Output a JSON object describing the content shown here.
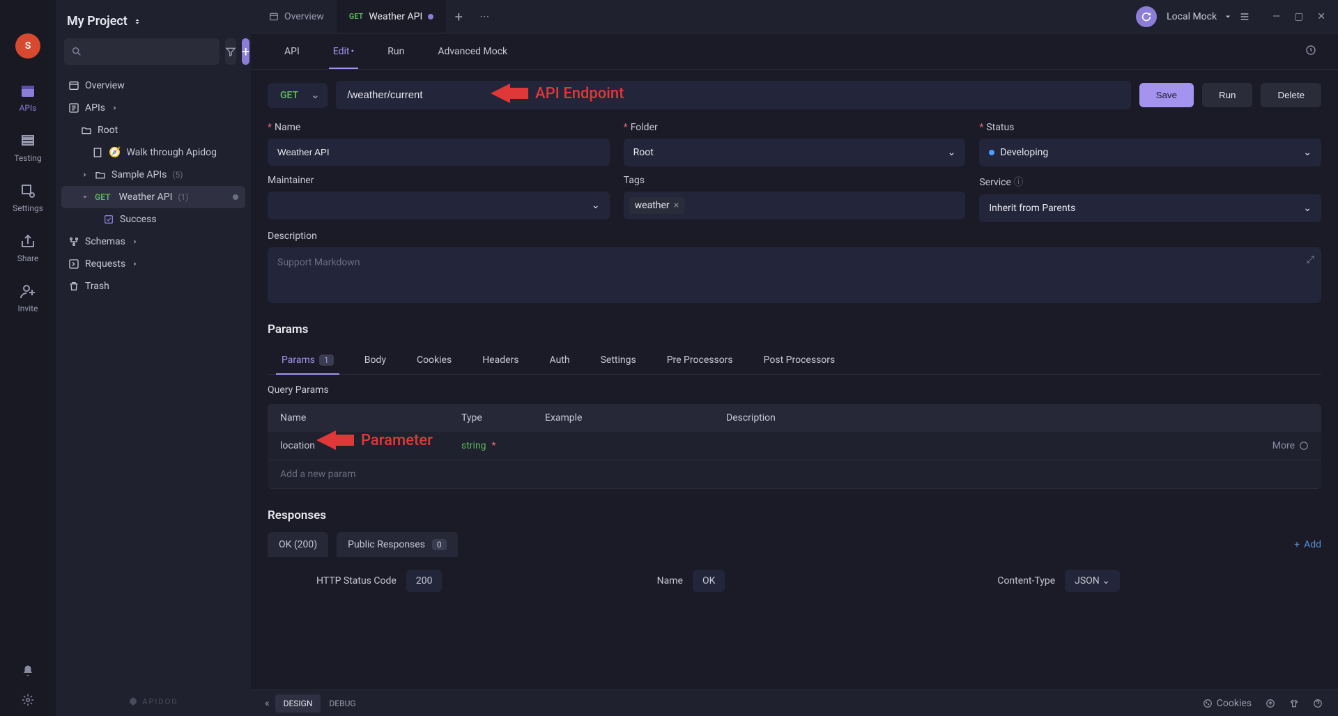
{
  "sidebar_narrow": {
    "avatar_letter": "S",
    "items": [
      {
        "label": "APIs",
        "icon": "calendar"
      },
      {
        "label": "Testing",
        "icon": "testing"
      },
      {
        "label": "Settings",
        "icon": "settings"
      },
      {
        "label": "Share",
        "icon": "share"
      },
      {
        "label": "Invite",
        "icon": "invite"
      }
    ]
  },
  "project": {
    "title": "My Project",
    "search_placeholder": "",
    "tree": {
      "overview": "Overview",
      "apis_label": "APIs",
      "root_label": "Root",
      "walkthrough": "Walk through Apidog",
      "sample_apis": "Sample APIs",
      "sample_count": "(5)",
      "weather_api": "Weather API",
      "weather_method": "GET",
      "weather_count": "(1)",
      "success": "Success",
      "schemas": "Schemas",
      "requests": "Requests",
      "trash": "Trash"
    },
    "brand": "APIDOG"
  },
  "tabs": {
    "overview": "Overview",
    "active_method": "GET",
    "active_label": "Weather API"
  },
  "topright": {
    "env": "Local Mock"
  },
  "subtabs": [
    "API",
    "Edit",
    "Run",
    "Advanced Mock"
  ],
  "endpoint": {
    "method": "GET",
    "path": "/weather/current",
    "save": "Save",
    "run": "Run",
    "delete": "Delete"
  },
  "annotations": {
    "endpoint": "API Endpoint",
    "parameter": "Parameter"
  },
  "meta": {
    "name_label": "Name",
    "name_value": "Weather API",
    "folder_label": "Folder",
    "folder_value": "Root",
    "status_label": "Status",
    "status_value": "Developing",
    "maintainer_label": "Maintainer",
    "tags_label": "Tags",
    "tag_value": "weather",
    "service_label": "Service",
    "service_value": "Inherit from Parents",
    "desc_label": "Description",
    "desc_placeholder": "Support Markdown"
  },
  "params": {
    "section": "Params",
    "tabs": [
      "Params",
      "Body",
      "Cookies",
      "Headers",
      "Auth",
      "Settings",
      "Pre Processors",
      "Post Processors"
    ],
    "count": "1",
    "query_label": "Query Params",
    "cols": {
      "name": "Name",
      "type": "Type",
      "example": "Example",
      "desc": "Description"
    },
    "rows": [
      {
        "name": "location",
        "type": "string",
        "required": "*",
        "example": "",
        "desc": ""
      }
    ],
    "add_placeholder": "Add a new param",
    "more": "More"
  },
  "responses": {
    "section": "Responses",
    "ok": "OK (200)",
    "public": "Public Responses",
    "public_count": "0",
    "add": "Add",
    "http_label": "HTTP Status Code",
    "http_value": "200",
    "name_label": "Name",
    "name_value": "OK",
    "ct_label": "Content-Type",
    "ct_value": "JSON"
  },
  "bottombar": {
    "design": "DESIGN",
    "debug": "DEBUG",
    "cookies": "Cookies"
  }
}
